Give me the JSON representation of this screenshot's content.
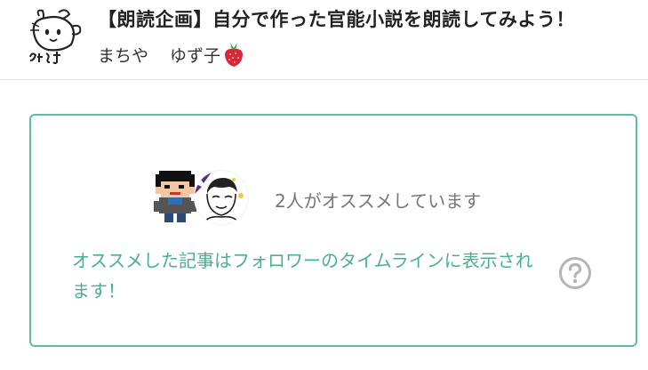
{
  "header": {
    "title": "【朗読企画】自分で作った官能小説を朗読してみよう！",
    "author_name": "まちや",
    "collaborator_name": "ゆず子",
    "collaborator_emoji_icon": "strawberry-icon",
    "avatar_icon": "author-avatar-illustration"
  },
  "recommend": {
    "count_text": "2人がオススメしています",
    "note_text": "オススメした記事はフォロワーのタイムラインに表示されます！",
    "help_icon": "question-circle-icon",
    "accent_color": "#5bbf9d",
    "text_accent_color": "#49b08c"
  }
}
